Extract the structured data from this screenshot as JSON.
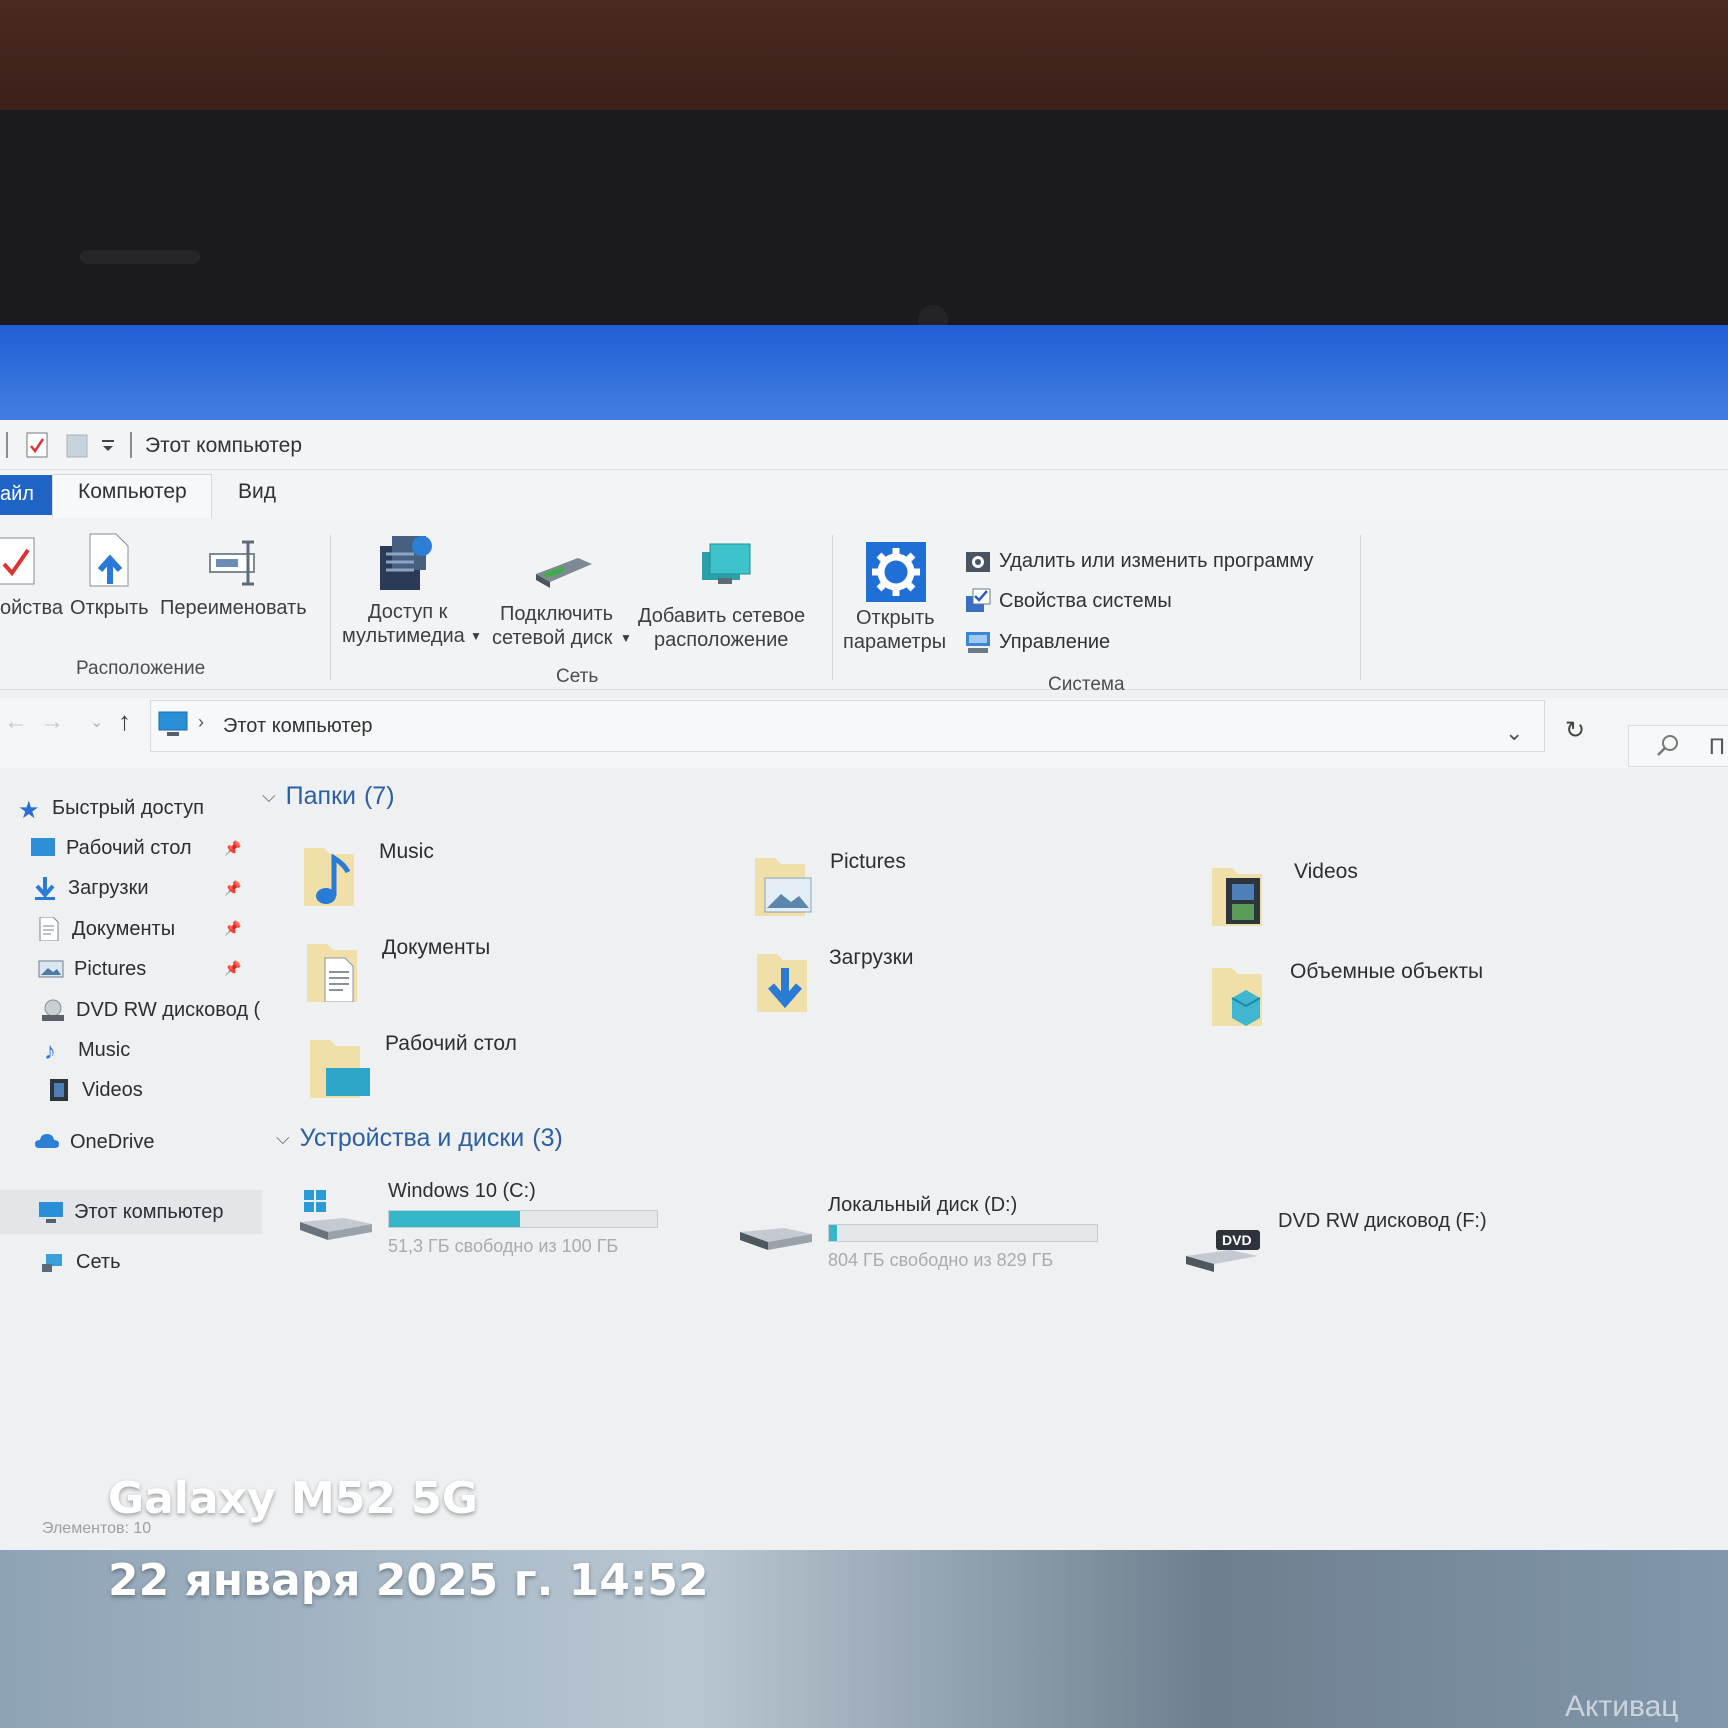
{
  "window": {
    "title": "Этот компьютер",
    "tabs": {
      "file": "айл",
      "computer": "Компьютер",
      "view": "Вид"
    }
  },
  "ribbon": {
    "properties": "ойства",
    "open": "Открыть",
    "rename": "Переименовать",
    "group_location": "Расположение",
    "media_access_line1": "Доступ к",
    "media_access_line2": "мультимедиа",
    "map_drive_line1": "Подключить",
    "map_drive_line2": "сетевой диск",
    "add_network_line1": "Добавить сетевое",
    "add_network_line2": "расположение",
    "group_network": "Сеть",
    "open_settings_line1": "Открыть",
    "open_settings_line2": "параметры",
    "uninstall": "Удалить или изменить программу",
    "system_properties": "Свойства системы",
    "manage": "Управление",
    "group_system": "Система"
  },
  "address": {
    "path": "Этот компьютер",
    "search_placeholder": "П"
  },
  "sidebar": {
    "quick_access": "Быстрый доступ",
    "items": [
      {
        "label": "Рабочий стол",
        "pinned": true
      },
      {
        "label": "Загрузки",
        "pinned": true
      },
      {
        "label": "Документы",
        "pinned": true
      },
      {
        "label": "Pictures",
        "pinned": true
      },
      {
        "label": "DVD RW дисковод (",
        "pinned": false
      },
      {
        "label": "Music",
        "pinned": false
      },
      {
        "label": "Videos",
        "pinned": false
      }
    ],
    "onedrive": "OneDrive",
    "this_pc": "Этот компьютер",
    "network": "Сеть"
  },
  "folders_section": {
    "title": "Папки",
    "count": "(7)"
  },
  "folders": [
    {
      "name": "Music"
    },
    {
      "name": "Pictures"
    },
    {
      "name": "Videos"
    },
    {
      "name": "Документы"
    },
    {
      "name": "Загрузки"
    },
    {
      "name": "Объемные объекты"
    },
    {
      "name": "Рабочий стол"
    }
  ],
  "devices_section": {
    "title": "Устройства и диски",
    "count": "(3)"
  },
  "drives": [
    {
      "name": "Windows 10 (C:)",
      "info": "51,3 ГБ свободно из 100 ГБ",
      "used_fraction": 0.487
    },
    {
      "name": "Локальный диск (D:)",
      "info": "804 ГБ свободно из 829 ГБ",
      "used_fraction": 0.03
    },
    {
      "name": "DVD RW дисковод (F:)",
      "badge": "DVD"
    }
  ],
  "status": {
    "items": "Элементов: 10"
  },
  "overlay": {
    "device": "Galaxy M52 5G",
    "datetime": "22 января 2025 г. 14:52",
    "watermark": "Активац"
  },
  "colors": {
    "accent": "#1f63c4",
    "drive_fill": "#33b7c9",
    "section_title": "#2d5fa4"
  }
}
